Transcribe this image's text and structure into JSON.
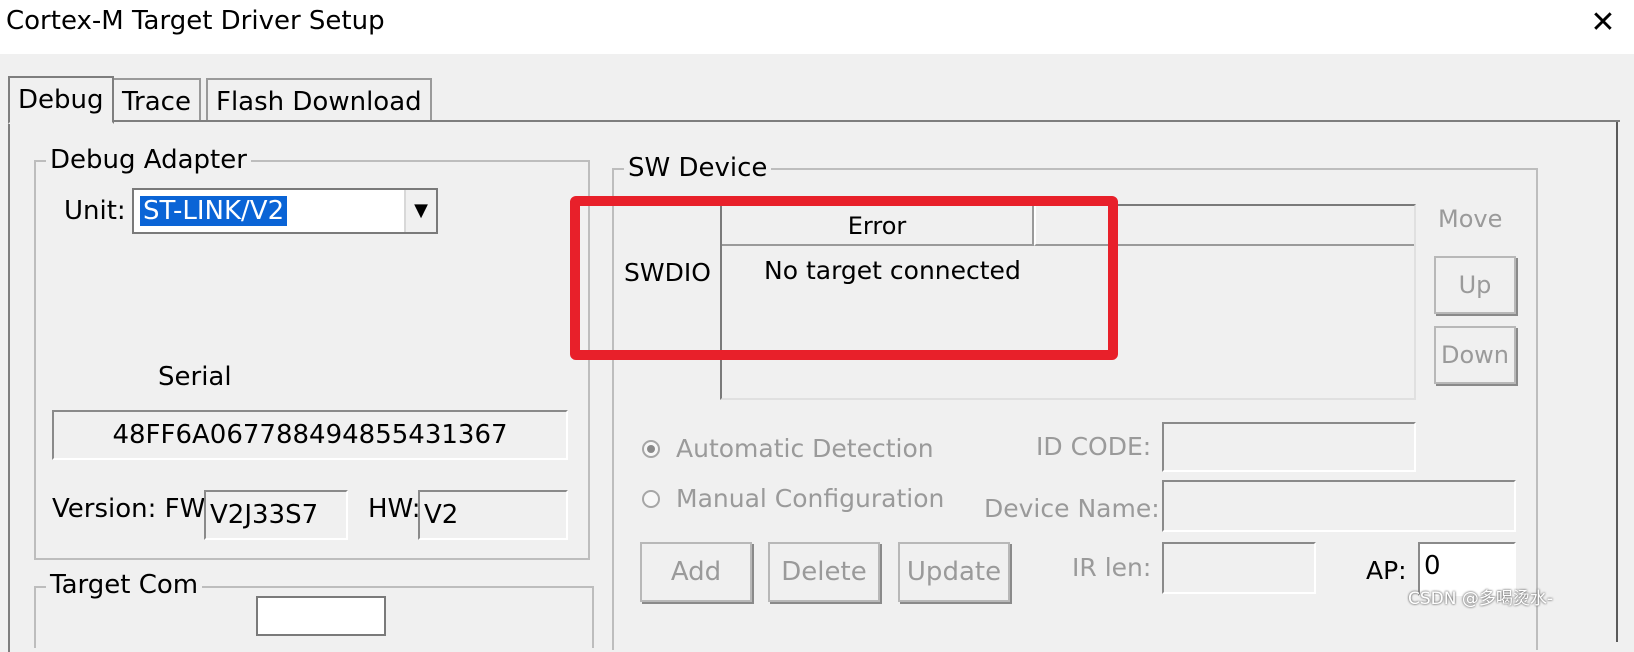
{
  "window": {
    "title": "Cortex-M Target Driver Setup",
    "close_label": "✕"
  },
  "tabs": [
    {
      "label": "Debug",
      "active": true
    },
    {
      "label": "Trace",
      "active": false
    },
    {
      "label": "Flash Download",
      "active": false
    }
  ],
  "debug_adapter": {
    "legend": "Debug Adapter",
    "unit_label": "Unit:",
    "unit_value": "ST-LINK/V2",
    "serial_label": "Serial",
    "serial_value": "48FF6A067788494855431367",
    "version_label": "Version: FW:",
    "fw_value": "V2J33S7",
    "hw_label": "HW:",
    "hw_value": "V2"
  },
  "target_com": {
    "legend": "Target Com"
  },
  "sw_device": {
    "legend": "SW Device",
    "row_label": "SWDIO",
    "column_header": "Error",
    "message": "No target connected",
    "move_label": "Move",
    "up_label": "Up",
    "down_label": "Down",
    "auto_detect_label": "Automatic Detection",
    "manual_config_label": "Manual Configuration",
    "id_code_label": "ID CODE:",
    "device_name_label": "Device Name:",
    "ir_len_label": "IR len:",
    "ap_label": "AP:",
    "ap_value": "0",
    "add_label": "Add",
    "delete_label": "Delete",
    "update_label": "Update"
  },
  "watermark": "CSDN @多喝烫水-",
  "colors": {
    "highlight": "#e8202a",
    "selection": "#0a64d6"
  }
}
